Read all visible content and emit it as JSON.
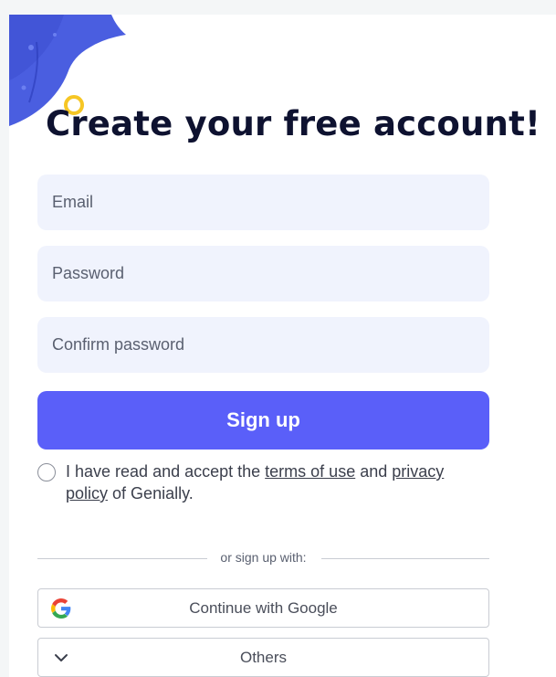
{
  "colors": {
    "accent": "#5a5ff9",
    "field_bg": "#f0f3fd",
    "title": "#0e1230"
  },
  "header": {
    "title": "Create your free account!"
  },
  "form": {
    "email_placeholder": "Email",
    "password_placeholder": "Password",
    "confirm_placeholder": "Confirm password",
    "submit_label": "Sign up"
  },
  "terms": {
    "prefix": "I have read and accept the",
    "terms_link": "terms of use",
    "middle": "and",
    "privacy_link": "privacy policy",
    "suffix": "of Genially."
  },
  "divider": {
    "label": "or sign up with:"
  },
  "social": {
    "google_label": "Continue with Google",
    "google_icon": "google-icon",
    "others_label": "Others",
    "others_icon": "chevron-down-icon"
  }
}
